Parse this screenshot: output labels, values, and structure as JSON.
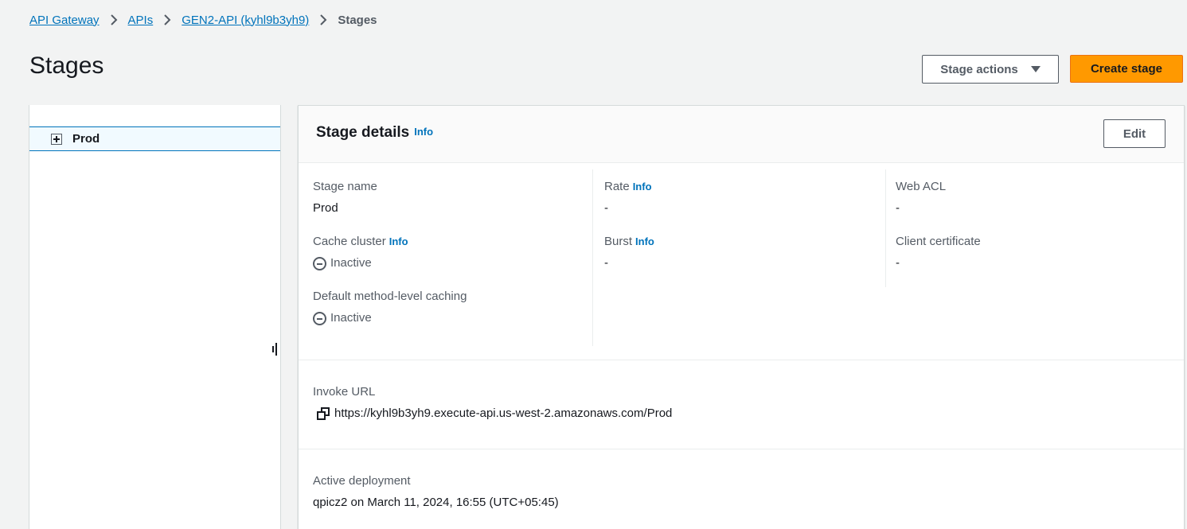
{
  "breadcrumb": {
    "items": [
      "API Gateway",
      "APIs",
      "GEN2-API (kyhl9b3yh9)"
    ],
    "current": "Stages"
  },
  "header": {
    "title": "Stages",
    "stage_actions_label": "Stage actions",
    "create_stage_label": "Create stage"
  },
  "tree": {
    "items": [
      {
        "label": "Prod",
        "selected": true,
        "expand_icon": "plus-square-icon"
      }
    ]
  },
  "details": {
    "title": "Stage details",
    "info_label": "Info",
    "edit_label": "Edit",
    "fields": {
      "stage_name": {
        "label": "Stage name",
        "value": "Prod"
      },
      "cache_cluster": {
        "label": "Cache cluster",
        "value": "Inactive",
        "info": "Info"
      },
      "default_caching": {
        "label": "Default method-level caching",
        "value": "Inactive"
      },
      "rate": {
        "label": "Rate",
        "value": "-",
        "info": "Info"
      },
      "burst": {
        "label": "Burst",
        "value": "-",
        "info": "Info"
      },
      "web_acl": {
        "label": "Web ACL",
        "value": "-"
      },
      "client_certificate": {
        "label": "Client certificate",
        "value": "-"
      },
      "invoke_url": {
        "label": "Invoke URL",
        "value": "https://kyhl9b3yh9.execute-api.us-west-2.amazonaws.com/Prod"
      },
      "active_deployment": {
        "label": "Active deployment",
        "value": "qpicz2 on March 11, 2024, 16:55 (UTC+05:45)"
      }
    }
  },
  "colors": {
    "link": "#0073bb",
    "primary_button": "#ff9900",
    "background": "#f2f3f3",
    "selected_row": "#f1faff"
  }
}
